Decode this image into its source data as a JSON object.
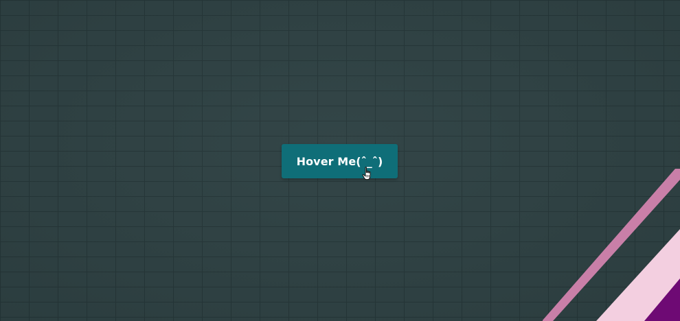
{
  "button": {
    "label": "Hover Me(ˆ_ˆ)"
  },
  "colors": {
    "background": "#2f4244",
    "brick_line": "#253638",
    "button_bg": "#0f6e78",
    "button_text": "#ffffff",
    "stripe_mauve": "#c97fa8",
    "stripe_light_pink": "#f3cfe0",
    "stripe_purple": "#6e0a74"
  },
  "icons": {
    "cursor": "hand-pointer-icon"
  }
}
